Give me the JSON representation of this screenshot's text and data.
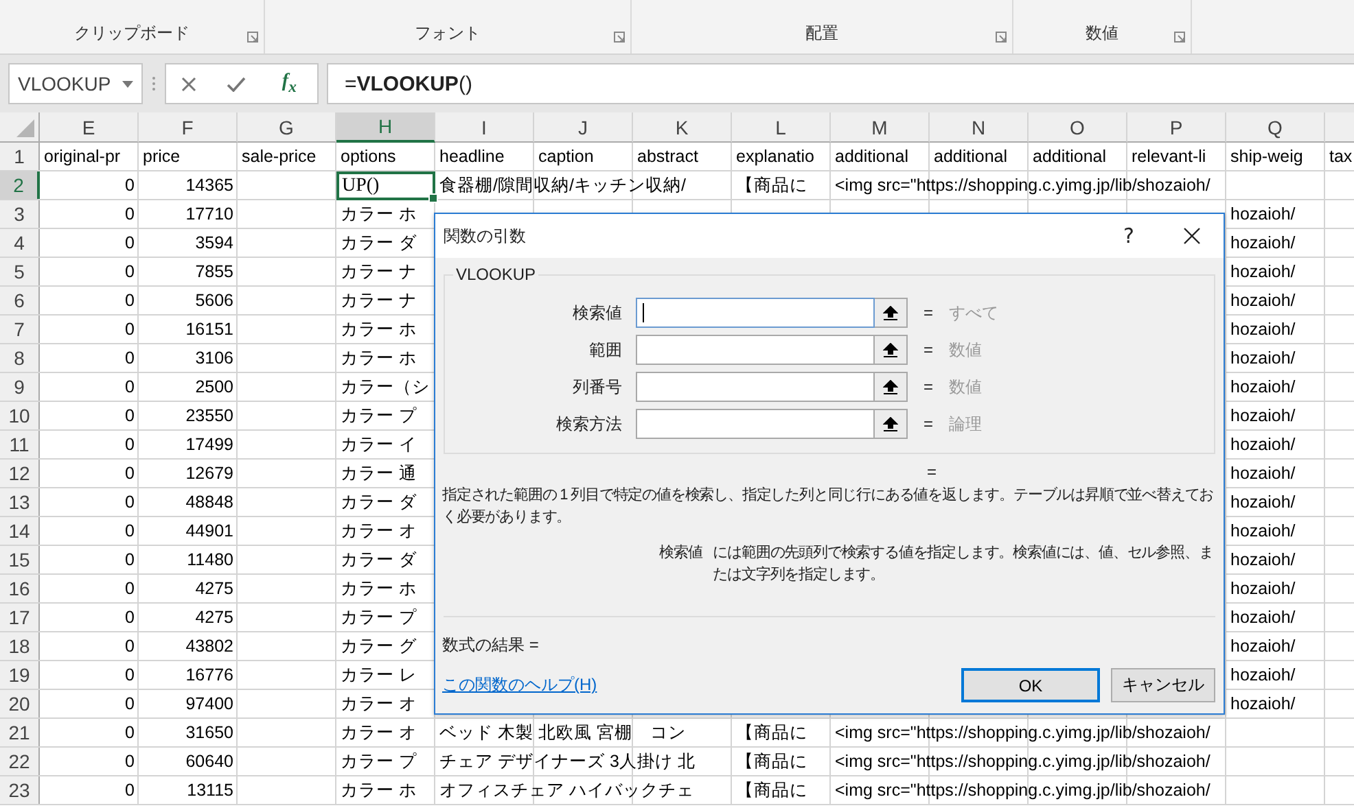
{
  "ribbon": {
    "groups": [
      {
        "label": "クリップボード"
      },
      {
        "label": "フォント"
      },
      {
        "label": "配置"
      },
      {
        "label": "数値"
      }
    ]
  },
  "formula_bar": {
    "name_box": "VLOOKUP",
    "fx": "f$_{x}$",
    "formula": "=**VLOOKUP**()"
  },
  "sheet": {
    "columns": [
      "E",
      "F",
      "G",
      "H",
      "I",
      "J",
      "K",
      "L",
      "M",
      "N",
      "O",
      "P",
      "Q"
    ],
    "rows": [
      {
        "header": "1",
        "cells": {
          "E": {
            "kind": "text",
            "text": "original-pr",
            "selected": false
          },
          "F": {
            "kind": "text",
            "text": "price",
            "selected": false
          },
          "G": {
            "kind": "text",
            "text": "sale-price",
            "selected": false
          },
          "H": {
            "kind": "text",
            "text": "options",
            "selected": false
          },
          "I": {
            "kind": "text",
            "text": "headline",
            "selected": false
          },
          "J": {
            "kind": "text",
            "text": "caption",
            "selected": false
          },
          "K": {
            "kind": "text",
            "text": "abstract",
            "selected": false
          },
          "L": {
            "kind": "text",
            "text": "explanatio",
            "selected": false
          },
          "M": {
            "kind": "text",
            "text": "additional",
            "selected": false
          },
          "N": {
            "kind": "text",
            "text": "additional",
            "selected": false
          },
          "O": {
            "kind": "text",
            "text": "additional",
            "selected": false
          },
          "P": {
            "kind": "text",
            "text": "relevant-li",
            "selected": false
          },
          "Q": {
            "kind": "text",
            "text": "ship-weig",
            "selected": false
          },
          "R": {
            "kind": "text",
            "text": "tax",
            "selected": false
          }
        }
      },
      {
        "header": "2",
        "cells": {
          "E": {
            "kind": "number",
            "text": "0",
            "selected": false
          },
          "F": {
            "kind": "number",
            "text": "14365",
            "selected": false
          },
          "H": {
            "kind": "edit",
            "text": "UP()",
            "selected": true
          },
          "I": {
            "kind": "text",
            "text": "食器棚/隙間収納/キッチン収納/",
            "selected": false
          },
          "L": {
            "kind": "text",
            "text": "【商品に",
            "selected": false
          },
          "M": {
            "kind": "text",
            "text": "<img src=\"https://shopping.c.yimg.jp/lib/shozaioh/",
            "selected": false
          }
        }
      },
      {
        "header": "3",
        "cells": {
          "E": {
            "kind": "number",
            "text": "0",
            "selected": false
          },
          "F": {
            "kind": "number",
            "text": "17710",
            "selected": false
          },
          "H": {
            "kind": "text",
            "text": "カラー ホ",
            "selected": false
          },
          "Q": {
            "kind": "text",
            "text": "hozaioh/",
            "selected": false
          }
        }
      },
      {
        "header": "4",
        "cells": {
          "E": {
            "kind": "number",
            "text": "0",
            "selected": false
          },
          "F": {
            "kind": "number",
            "text": "3594",
            "selected": false
          },
          "H": {
            "kind": "text",
            "text": "カラー ダ",
            "selected": false
          },
          "Q": {
            "kind": "text",
            "text": "hozaioh/",
            "selected": false
          }
        }
      },
      {
        "header": "5",
        "cells": {
          "E": {
            "kind": "number",
            "text": "0",
            "selected": false
          },
          "F": {
            "kind": "number",
            "text": "7855",
            "selected": false
          },
          "H": {
            "kind": "text",
            "text": "カラー ナ",
            "selected": false
          },
          "Q": {
            "kind": "text",
            "text": "hozaioh/",
            "selected": false
          }
        }
      },
      {
        "header": "6",
        "cells": {
          "E": {
            "kind": "number",
            "text": "0",
            "selected": false
          },
          "F": {
            "kind": "number",
            "text": "5606",
            "selected": false
          },
          "H": {
            "kind": "text",
            "text": "カラー ナ",
            "selected": false
          },
          "Q": {
            "kind": "text",
            "text": "hozaioh/",
            "selected": false
          }
        }
      },
      {
        "header": "7",
        "cells": {
          "E": {
            "kind": "number",
            "text": "0",
            "selected": false
          },
          "F": {
            "kind": "number",
            "text": "16151",
            "selected": false
          },
          "H": {
            "kind": "text",
            "text": "カラー ホ",
            "selected": false
          },
          "Q": {
            "kind": "text",
            "text": "hozaioh/",
            "selected": false
          }
        }
      },
      {
        "header": "8",
        "cells": {
          "E": {
            "kind": "number",
            "text": "0",
            "selected": false
          },
          "F": {
            "kind": "number",
            "text": "3106",
            "selected": false
          },
          "H": {
            "kind": "text",
            "text": "カラー ホ",
            "selected": false
          },
          "Q": {
            "kind": "text",
            "text": "hozaioh/",
            "selected": false
          }
        }
      },
      {
        "header": "9",
        "cells": {
          "E": {
            "kind": "number",
            "text": "0",
            "selected": false
          },
          "F": {
            "kind": "number",
            "text": "2500",
            "selected": false
          },
          "H": {
            "kind": "text",
            "text": "カラー（シ",
            "selected": false
          },
          "Q": {
            "kind": "text",
            "text": "hozaioh/",
            "selected": false
          }
        }
      },
      {
        "header": "10",
        "cells": {
          "E": {
            "kind": "number",
            "text": "0",
            "selected": false
          },
          "F": {
            "kind": "number",
            "text": "23550",
            "selected": false
          },
          "H": {
            "kind": "text",
            "text": "カラー プ",
            "selected": false
          },
          "Q": {
            "kind": "text",
            "text": "hozaioh/",
            "selected": false
          }
        }
      },
      {
        "header": "11",
        "cells": {
          "E": {
            "kind": "number",
            "text": "0",
            "selected": false
          },
          "F": {
            "kind": "number",
            "text": "17499",
            "selected": false
          },
          "H": {
            "kind": "text",
            "text": "カラー イ",
            "selected": false
          },
          "Q": {
            "kind": "text",
            "text": "hozaioh/",
            "selected": false
          }
        }
      },
      {
        "header": "12",
        "cells": {
          "E": {
            "kind": "number",
            "text": "0",
            "selected": false
          },
          "F": {
            "kind": "number",
            "text": "12679",
            "selected": false
          },
          "H": {
            "kind": "text",
            "text": "カラー 通",
            "selected": false
          },
          "Q": {
            "kind": "text",
            "text": "hozaioh/",
            "selected": false
          }
        }
      },
      {
        "header": "13",
        "cells": {
          "E": {
            "kind": "number",
            "text": "0",
            "selected": false
          },
          "F": {
            "kind": "number",
            "text": "48848",
            "selected": false
          },
          "H": {
            "kind": "text",
            "text": "カラー ダ",
            "selected": false
          },
          "Q": {
            "kind": "text",
            "text": "hozaioh/",
            "selected": false
          }
        }
      },
      {
        "header": "14",
        "cells": {
          "E": {
            "kind": "number",
            "text": "0",
            "selected": false
          },
          "F": {
            "kind": "number",
            "text": "44901",
            "selected": false
          },
          "H": {
            "kind": "text",
            "text": "カラー オ",
            "selected": false
          },
          "Q": {
            "kind": "text",
            "text": "hozaioh/",
            "selected": false
          }
        }
      },
      {
        "header": "15",
        "cells": {
          "E": {
            "kind": "number",
            "text": "0",
            "selected": false
          },
          "F": {
            "kind": "number",
            "text": "11480",
            "selected": false
          },
          "H": {
            "kind": "text",
            "text": "カラー ダ",
            "selected": false
          },
          "Q": {
            "kind": "text",
            "text": "hozaioh/",
            "selected": false
          }
        }
      },
      {
        "header": "16",
        "cells": {
          "E": {
            "kind": "number",
            "text": "0",
            "selected": false
          },
          "F": {
            "kind": "number",
            "text": "4275",
            "selected": false
          },
          "H": {
            "kind": "text",
            "text": "カラー ホ",
            "selected": false
          },
          "Q": {
            "kind": "text",
            "text": "hozaioh/",
            "selected": false
          }
        }
      },
      {
        "header": "17",
        "cells": {
          "E": {
            "kind": "number",
            "text": "0",
            "selected": false
          },
          "F": {
            "kind": "number",
            "text": "4275",
            "selected": false
          },
          "H": {
            "kind": "text",
            "text": "カラー プ",
            "selected": false
          },
          "Q": {
            "kind": "text",
            "text": "hozaioh/",
            "selected": false
          }
        }
      },
      {
        "header": "18",
        "cells": {
          "E": {
            "kind": "number",
            "text": "0",
            "selected": false
          },
          "F": {
            "kind": "number",
            "text": "43802",
            "selected": false
          },
          "H": {
            "kind": "text",
            "text": "カラー グ",
            "selected": false
          },
          "Q": {
            "kind": "text",
            "text": "hozaioh/",
            "selected": false
          }
        }
      },
      {
        "header": "19",
        "cells": {
          "E": {
            "kind": "number",
            "text": "0",
            "selected": false
          },
          "F": {
            "kind": "number",
            "text": "16776",
            "selected": false
          },
          "H": {
            "kind": "text",
            "text": "カラー レ",
            "selected": false
          },
          "Q": {
            "kind": "text",
            "text": "hozaioh/",
            "selected": false
          }
        }
      },
      {
        "header": "20",
        "cells": {
          "E": {
            "kind": "number",
            "text": "0",
            "selected": false
          },
          "F": {
            "kind": "number",
            "text": "97400",
            "selected": false
          },
          "H": {
            "kind": "text",
            "text": "カラー オ",
            "selected": false
          },
          "Q": {
            "kind": "text",
            "text": "hozaioh/",
            "selected": false
          }
        }
      },
      {
        "header": "21",
        "cells": {
          "E": {
            "kind": "number",
            "text": "0",
            "selected": false
          },
          "F": {
            "kind": "number",
            "text": "31650",
            "selected": false
          },
          "H": {
            "kind": "text",
            "text": "カラー オ",
            "selected": false
          },
          "I": {
            "kind": "text",
            "text": "ベッド 木製 北欧風 宮棚　コン",
            "selected": false
          },
          "L": {
            "kind": "text",
            "text": "【商品に",
            "selected": false
          },
          "M": {
            "kind": "text",
            "text": "<img src=\"https://shopping.c.yimg.jp/lib/shozaioh/",
            "selected": false
          }
        }
      },
      {
        "header": "22",
        "cells": {
          "E": {
            "kind": "number",
            "text": "0",
            "selected": false
          },
          "F": {
            "kind": "number",
            "text": "60640",
            "selected": false
          },
          "H": {
            "kind": "text",
            "text": "カラー プ",
            "selected": false
          },
          "I": {
            "kind": "text",
            "text": "チェア デザイナーズ 3人掛け 北",
            "selected": false
          },
          "L": {
            "kind": "text",
            "text": "【商品に",
            "selected": false
          },
          "M": {
            "kind": "text",
            "text": "<img src=\"https://shopping.c.yimg.jp/lib/shozaioh/",
            "selected": false
          }
        }
      },
      {
        "header": "23",
        "cells": {
          "E": {
            "kind": "number",
            "text": "0",
            "selected": false
          },
          "F": {
            "kind": "number",
            "text": "13115",
            "selected": false
          },
          "H": {
            "kind": "text",
            "text": "カラー ホ",
            "selected": false
          },
          "I": {
            "kind": "text",
            "text": "オフィスチェア ハイバックチェ",
            "selected": false
          },
          "L": {
            "kind": "text",
            "text": "【商品に",
            "selected": false
          },
          "M": {
            "kind": "text",
            "text": "<img src=\"https://shopping.c.yimg.jp/lib/shozaioh/",
            "selected": false
          }
        }
      }
    ]
  },
  "dialog": {
    "title": "関数の引数",
    "help_button": "?",
    "function_name": "VLOOKUP",
    "arguments": [
      {
        "label": "検索値",
        "focused": true,
        "equals": "=",
        "result": "すべて"
      },
      {
        "label": "範囲",
        "focused": false,
        "equals": "=",
        "result": "数値"
      },
      {
        "label": "列番号",
        "focused": false,
        "equals": "=",
        "result": "数値"
      },
      {
        "label": "検索方法",
        "focused": false,
        "equals": "=",
        "result": "論理"
      }
    ],
    "overall_equals": "=",
    "description": "指定された範囲の 1 列目で特定の値を検索し、指定した列と同じ行にある値を返します。テーブルは昇順で並べ替えておく必要があります。",
    "argument_help": {
      "name": "検索値",
      "text": "には範囲の先頭列で検索する値を指定します。検索値には、値、セル参照、または文字列を指定します。"
    },
    "formula_result": "数式の結果 =",
    "help_link": "この関数のヘルプ(H)",
    "buttons": [
      {
        "label": "OK",
        "default": true
      },
      {
        "label": "キャンセル",
        "default": false
      }
    ]
  }
}
